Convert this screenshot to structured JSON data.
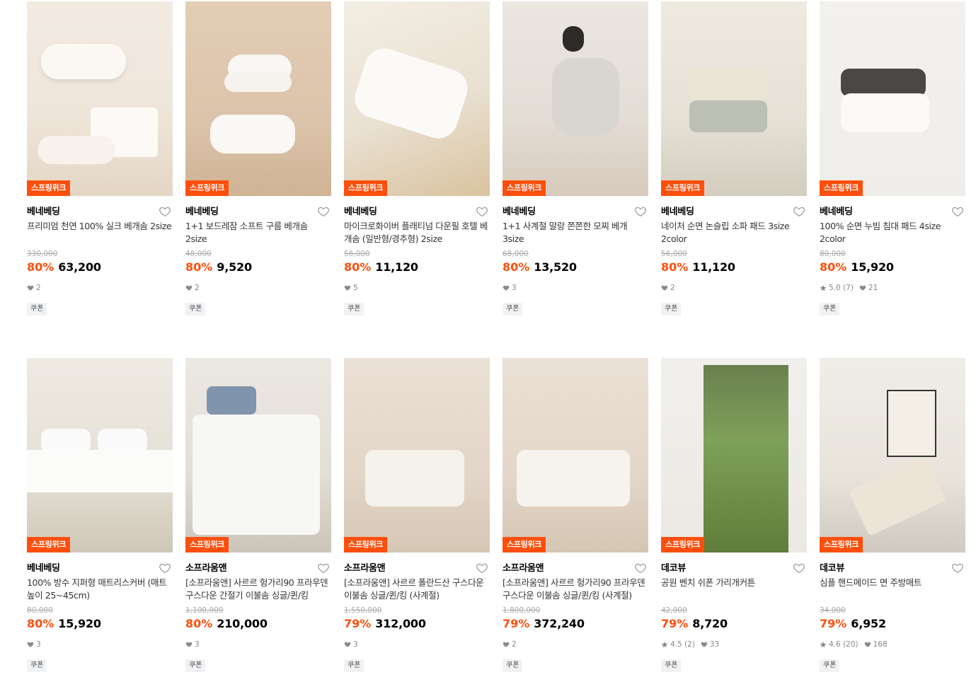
{
  "badge": "스프링위크",
  "coupon": "쿠폰",
  "colors": {
    "accent": "#ff4f0d"
  },
  "products": [
    {
      "brand": "베네베딩",
      "title": "프리미엄 천연 100% 실크 베개솜 2size",
      "orig": "330,000",
      "discount": "80%",
      "price": "63,200",
      "likes": "2",
      "rating": ""
    },
    {
      "brand": "베네베딩",
      "title": "1+1 보드레잠 소프트 구름 베개솜 2size",
      "orig": "48,000",
      "discount": "80%",
      "price": "9,520",
      "likes": "2",
      "rating": ""
    },
    {
      "brand": "베네베딩",
      "title": "마이크로화이버 플래티넘 다운필 호텔 베개솜 (일반형/경추형) 2size",
      "orig": "56,000",
      "discount": "80%",
      "price": "11,120",
      "likes": "5",
      "rating": ""
    },
    {
      "brand": "베네베딩",
      "title": "1+1 사계절 말랑 쫀쫀한 모찌 베개 3size",
      "orig": "68,000",
      "discount": "80%",
      "price": "13,520",
      "likes": "3",
      "rating": ""
    },
    {
      "brand": "베네베딩",
      "title": "네이처 순면 논슬립 소파 패드 3size 2color",
      "orig": "56,000",
      "discount": "80%",
      "price": "11,120",
      "likes": "2",
      "rating": ""
    },
    {
      "brand": "베네베딩",
      "title": "100% 순면 누빔 침대 패드 4size 2color",
      "orig": "80,000",
      "discount": "80%",
      "price": "15,920",
      "likes": "21",
      "rating": "5.0 (7)"
    },
    {
      "brand": "베네베딩",
      "title": "100% 방수 지퍼형 매트리스커버 (매트높이 25~45cm)",
      "orig": "80,000",
      "discount": "80%",
      "price": "15,920",
      "likes": "3",
      "rating": ""
    },
    {
      "brand": "소프라움앤",
      "title": "[소프라움앤] 사르르 헝가리90 프라우덴 구스다운 간절기 이불솜 싱글/퀸/킹",
      "orig": "1,100,000",
      "discount": "80%",
      "price": "210,000",
      "likes": "3",
      "rating": ""
    },
    {
      "brand": "소프라움앤",
      "title": "[소프라움앤] 사르르 폴란드산 구스다운 이불솜 싱글/퀸/킹 (사계절)",
      "orig": "1,550,000",
      "discount": "79%",
      "price": "312,000",
      "likes": "3",
      "rating": ""
    },
    {
      "brand": "소프라움앤",
      "title": "[소프라움앤] 사르르 헝가리90 프라우덴 구스다운 이불솜 싱글/퀸/킹 (사계절)",
      "orig": "1,800,000",
      "discount": "79%",
      "price": "372,240",
      "likes": "2",
      "rating": ""
    },
    {
      "brand": "데코뷰",
      "title": "공원 벤치 쉬폰 가리개커튼",
      "orig": "42,000",
      "discount": "79%",
      "price": "8,720",
      "likes": "33",
      "rating": "4.5 (2)"
    },
    {
      "brand": "데코뷰",
      "title": "심플 핸드메이드 면 주방매트",
      "orig": "34,000",
      "discount": "79%",
      "price": "6,952",
      "likes": "168",
      "rating": "4.6 (20)"
    }
  ]
}
